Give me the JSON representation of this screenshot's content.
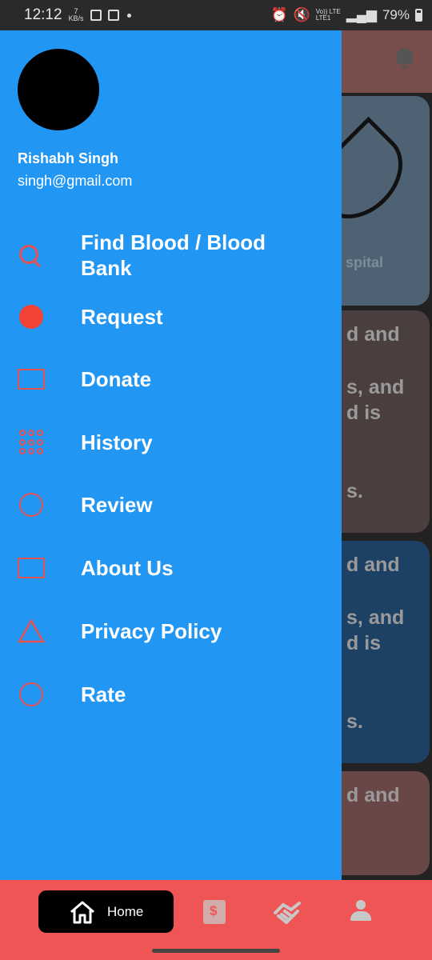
{
  "status_bar": {
    "time": "12:12",
    "net_speed_value": "7",
    "net_speed_unit": "KB/s",
    "signal_label_top": "Vo)) LTE",
    "signal_label_bottom": "LTE1",
    "battery": "79%"
  },
  "background": {
    "card1_caption": "spital",
    "card2_lines": [
      "d and",
      "",
      "s, and",
      "d is",
      "",
      "s."
    ],
    "card3_lines": [
      "d and",
      "",
      "s, and",
      "d is",
      "",
      "s."
    ],
    "card4_lines": [
      "d and"
    ]
  },
  "drawer": {
    "user_name": "Rishabh Singh",
    "user_email": "singh@gmail.com",
    "items": [
      {
        "label": "Find Blood /  Blood Bank",
        "icon": "search-icon"
      },
      {
        "label": "Request",
        "icon": "filled-circle-icon"
      },
      {
        "label": "Donate",
        "icon": "rectangle-icon"
      },
      {
        "label": "History",
        "icon": "grid-icon"
      },
      {
        "label": "Review",
        "icon": "circle-icon"
      },
      {
        "label": "About Us",
        "icon": "rectangle-icon"
      },
      {
        "label": "Privacy Policy",
        "icon": "triangle-icon"
      },
      {
        "label": "Rate",
        "icon": "circle-icon"
      }
    ]
  },
  "bottom_nav": {
    "home_label": "Home",
    "items": [
      "home-icon",
      "document-icon",
      "handshake-icon",
      "person-icon"
    ]
  },
  "colors": {
    "drawer_bg": "#2196f3",
    "accent_red": "#f05555",
    "icon_red": "#e55050"
  }
}
